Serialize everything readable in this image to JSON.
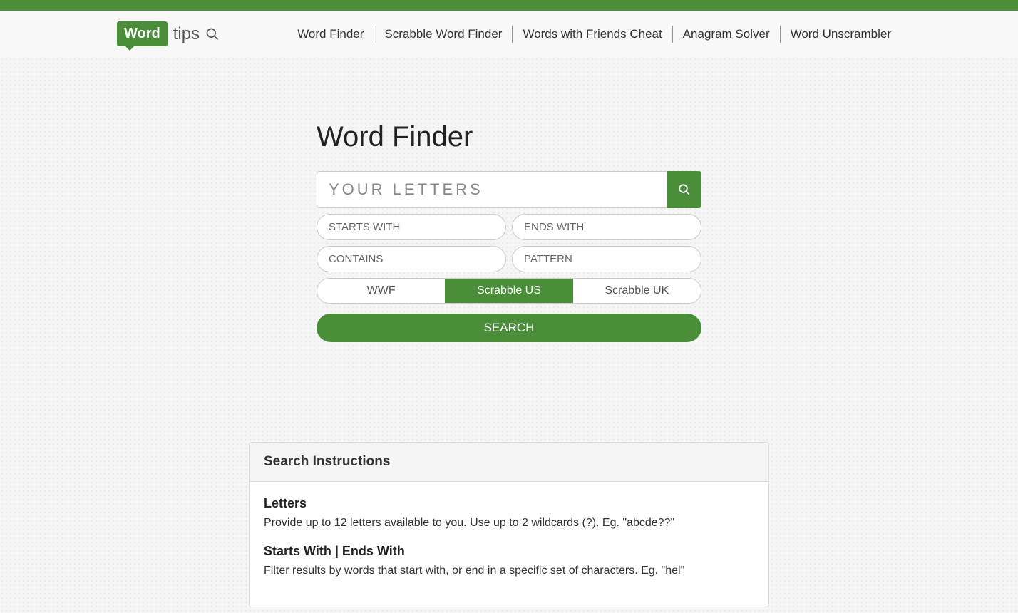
{
  "logo": {
    "word": "Word",
    "tips": "tips"
  },
  "nav": {
    "items": [
      "Word Finder",
      "Scrabble Word Finder",
      "Words with Friends Cheat",
      "Anagram Solver",
      "Word Unscrambler"
    ]
  },
  "main": {
    "title": "Word Finder",
    "letters_placeholder": "YOUR LETTERS",
    "starts_placeholder": "STARTS WITH",
    "ends_placeholder": "ENDS WITH",
    "contains_placeholder": "CONTAINS",
    "pattern_placeholder": "PATTERN",
    "dict_options": [
      "WWF",
      "Scrabble US",
      "Scrabble UK"
    ],
    "dict_active_index": 1,
    "search_label": "SEARCH"
  },
  "instructions": {
    "header": "Search Instructions",
    "sections": [
      {
        "title": "Letters",
        "text": "Provide up to 12 letters available to you. Use up to 2 wildcards (?). Eg. \"abcde??\""
      },
      {
        "title": "Starts With | Ends With",
        "text": "Filter results by words that start with, or end in a specific set of characters. Eg. \"hel\""
      }
    ]
  }
}
